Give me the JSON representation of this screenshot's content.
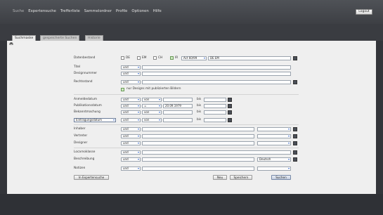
{
  "topnav": [
    "Suche",
    "Expertensuche",
    "Trefferliste",
    "Sammelordner",
    "Profile",
    "Optionen",
    "Hilfe"
  ],
  "logout": "Logout",
  "tabs": [
    "Suchmaske",
    "gespeicherte Suchen",
    "Historie"
  ],
  "form": {
    "datenbestand": {
      "label": "Datenbestand",
      "options": [
        "DE",
        "EM",
        "CH",
        "IR"
      ],
      "ir_value": "Act 60/99",
      "selection_text": "DE EM"
    },
    "titel": "Titel",
    "designnummer": "Designnummer",
    "rechtsstand": "Rechtsstand",
    "published_only": "nur Designs mit publizierten Bildern",
    "anmeldedatum": "Anmeldedatum",
    "publikationsdatum": "Publikationsdatum",
    "bekanntmachung": "Bekanntmachung",
    "eintragungsdatum": "Eintragungsdatum",
    "inhaber": "Inhaber",
    "vertreter": "Vertreter",
    "designer": "Designer",
    "locarnoklasse": "Locarnoklasse",
    "beschreibung": "Beschreibung",
    "beschreibung_lang": "Deutsch",
    "notizen": "Notizen",
    "op_und": "und",
    "op_von": "von",
    "op_eq": "=",
    "bis": "bis",
    "date_value": "20.09.1979"
  },
  "buttons": {
    "expert": "In Expertensuche",
    "neu": "Neu",
    "speichern": "Speichern",
    "suchen": "Suchen"
  }
}
